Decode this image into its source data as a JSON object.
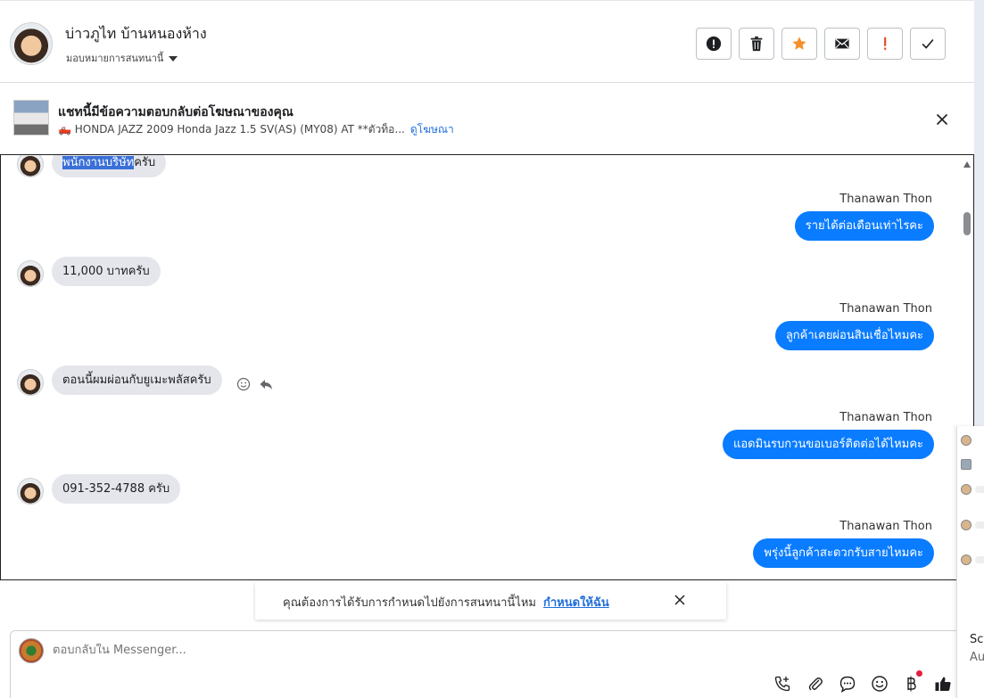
{
  "header": {
    "contact_name": "บ่าวภูไท บ้านหนองห้าง",
    "assign_label": "มอบหมายการสนทนานี้",
    "actions": [
      "mark-spam",
      "delete",
      "star",
      "mark-unread",
      "follow-up",
      "mark-done"
    ]
  },
  "ad_banner": {
    "title": "แชทนี้มีข้อความตอบกลับต่อโฆษณาของคุณ",
    "subtitle": "🛻 HONDA JAZZ 2009 Honda Jazz 1.5 SV(AS) (MY08) AT **ตัวท็อ...",
    "view_ad_label": "ดูโฆษณา"
  },
  "messages": [
    {
      "from": "customer",
      "text_selected": "พนักงานบริษัท",
      "text_rest": "ครับ"
    },
    {
      "from": "agent",
      "sender": "Thanawan Thon",
      "text": "รายได้ต่อเดือนเท่าไรคะ"
    },
    {
      "from": "customer",
      "text": "11,000 บาทครับ"
    },
    {
      "from": "agent",
      "sender": "Thanawan Thon",
      "text": "ลูกค้าเคยผ่อนสินเชื่อไหมคะ"
    },
    {
      "from": "customer",
      "text": "ตอนนี้ผมผ่อนกับยูเมะพลัสครับ"
    },
    {
      "from": "agent",
      "sender": "Thanawan Thon",
      "text": "แอดมินรบกวนขอเบอร์ติดต่อได้ไหมคะ"
    },
    {
      "from": "customer",
      "text": "091-352-4788 ครับ"
    },
    {
      "from": "agent",
      "sender": "Thanawan Thon",
      "text": "พรุ่งนี้ลูกค้าสะดวกรับสายไหมคะ"
    }
  ],
  "toast": {
    "text": "คุณต้องการได้รับการกำหนดไปยังการสนทนานี้ไหม",
    "link": "กำหนดให้ฉัน"
  },
  "composer": {
    "placeholder": "ตอบกลับใน Messenger..."
  },
  "side_panel": {
    "text1": "Scr",
    "text2": "Au"
  },
  "colors": {
    "accent": "#0a7cff",
    "link": "#216fdb",
    "incoming_bubble": "#e4e6eb",
    "notification_dot": "#e41e3f"
  }
}
